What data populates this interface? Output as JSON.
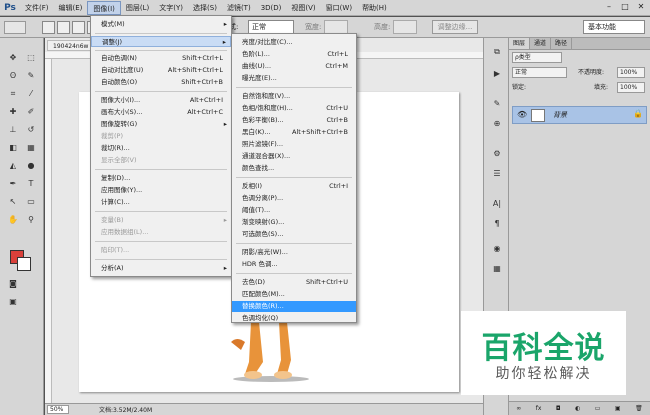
{
  "app": {
    "logo": "Ps"
  },
  "menubar": {
    "items": [
      {
        "label": "文件(F)"
      },
      {
        "label": "编辑(E)"
      },
      {
        "label": "图像(I)"
      },
      {
        "label": "图层(L)"
      },
      {
        "label": "文字(Y)"
      },
      {
        "label": "选择(S)"
      },
      {
        "label": "滤镜(T)"
      },
      {
        "label": "3D(D)"
      },
      {
        "label": "视图(V)"
      },
      {
        "label": "窗口(W)"
      },
      {
        "label": "帮助(H)"
      }
    ],
    "window_controls": [
      "–",
      "□",
      "✕"
    ]
  },
  "options": {
    "style_label": "样式:",
    "style_value": "正常",
    "width_label": "宽度:",
    "height_label": "高度:",
    "refine_label": "调整边缘...",
    "workspace": "基本功能"
  },
  "document": {
    "tab_title": "190424n6w",
    "zoom": "50%",
    "doc_info": "文档:3.52M/2.40M"
  },
  "colors": {
    "foreground": "#d9403a",
    "background": "#ffffff",
    "menu_highlight": "#3399ff"
  },
  "image_menu": {
    "items": [
      {
        "label": "模式(M)",
        "shortcut": "",
        "arrow": "▸",
        "disabled": false
      },
      {
        "label": "调整(J)",
        "shortcut": "",
        "arrow": "▸",
        "disabled": false
      },
      {
        "label": "自动色调(N)",
        "shortcut": "Shift+Ctrl+L",
        "disabled": false
      },
      {
        "label": "自动对比度(U)",
        "shortcut": "Alt+Shift+Ctrl+L",
        "disabled": false
      },
      {
        "label": "自动颜色(O)",
        "shortcut": "Shift+Ctrl+B",
        "disabled": false
      },
      {
        "label": "图像大小(I)...",
        "shortcut": "Alt+Ctrl+I",
        "disabled": false
      },
      {
        "label": "画布大小(S)...",
        "shortcut": "Alt+Ctrl+C",
        "disabled": false
      },
      {
        "label": "图像旋转(G)",
        "shortcut": "",
        "arrow": "▸",
        "disabled": false
      },
      {
        "label": "裁剪(P)",
        "shortcut": "",
        "disabled": true
      },
      {
        "label": "裁切(R)...",
        "shortcut": "",
        "disabled": false
      },
      {
        "label": "显示全部(V)",
        "shortcut": "",
        "disabled": true
      },
      {
        "label": "复制(D)...",
        "shortcut": "",
        "disabled": false
      },
      {
        "label": "应用图像(Y)...",
        "shortcut": "",
        "disabled": false
      },
      {
        "label": "计算(C)...",
        "shortcut": "",
        "disabled": false
      },
      {
        "label": "变量(B)",
        "shortcut": "",
        "arrow": "▸",
        "disabled": true
      },
      {
        "label": "应用数据组(L)...",
        "shortcut": "",
        "disabled": true
      },
      {
        "label": "陷印(T)...",
        "shortcut": "",
        "disabled": true
      },
      {
        "label": "分析(A)",
        "shortcut": "",
        "arrow": "▸",
        "disabled": false
      }
    ]
  },
  "adjust_submenu": {
    "items": [
      {
        "label": "亮度/对比度(C)...",
        "shortcut": ""
      },
      {
        "label": "色阶(L)...",
        "shortcut": "Ctrl+L"
      },
      {
        "label": "曲线(U)...",
        "shortcut": "Ctrl+M"
      },
      {
        "label": "曝光度(E)...",
        "shortcut": ""
      },
      {
        "label": "自然饱和度(V)...",
        "shortcut": ""
      },
      {
        "label": "色相/饱和度(H)...",
        "shortcut": "Ctrl+U"
      },
      {
        "label": "色彩平衡(B)...",
        "shortcut": "Ctrl+B"
      },
      {
        "label": "黑白(K)...",
        "shortcut": "Alt+Shift+Ctrl+B"
      },
      {
        "label": "照片滤镜(F)...",
        "shortcut": ""
      },
      {
        "label": "通道混合器(X)...",
        "shortcut": ""
      },
      {
        "label": "颜色查找...",
        "shortcut": ""
      },
      {
        "label": "反相(I)",
        "shortcut": "Ctrl+I"
      },
      {
        "label": "色调分离(P)...",
        "shortcut": ""
      },
      {
        "label": "阈值(T)...",
        "shortcut": ""
      },
      {
        "label": "渐变映射(G)...",
        "shortcut": ""
      },
      {
        "label": "可选颜色(S)...",
        "shortcut": ""
      },
      {
        "label": "阴影/高光(W)...",
        "shortcut": ""
      },
      {
        "label": "HDR 色调...",
        "shortcut": ""
      },
      {
        "label": "去色(D)",
        "shortcut": "Shift+Ctrl+U"
      },
      {
        "label": "匹配颜色(M)...",
        "shortcut": ""
      },
      {
        "label": "替换颜色(R)...",
        "shortcut": ""
      },
      {
        "label": "色调均化(Q)",
        "shortcut": ""
      }
    ]
  },
  "layers_panel": {
    "tabs": [
      "图层",
      "通道",
      "路径"
    ],
    "kind_filter": "ρ类型",
    "blend_mode": "正常",
    "opacity_label": "不透明度:",
    "opacity_value": "100%",
    "lock_label": "锁定:",
    "fill_label": "填充:",
    "fill_value": "100%",
    "layer_name": "背景",
    "footer_icons": [
      "∞",
      "fx",
      "◘",
      "◐",
      "▭",
      "▣",
      "🗑"
    ]
  },
  "watermark": {
    "title": "百科全说",
    "subtitle": "助你轻松解决"
  }
}
